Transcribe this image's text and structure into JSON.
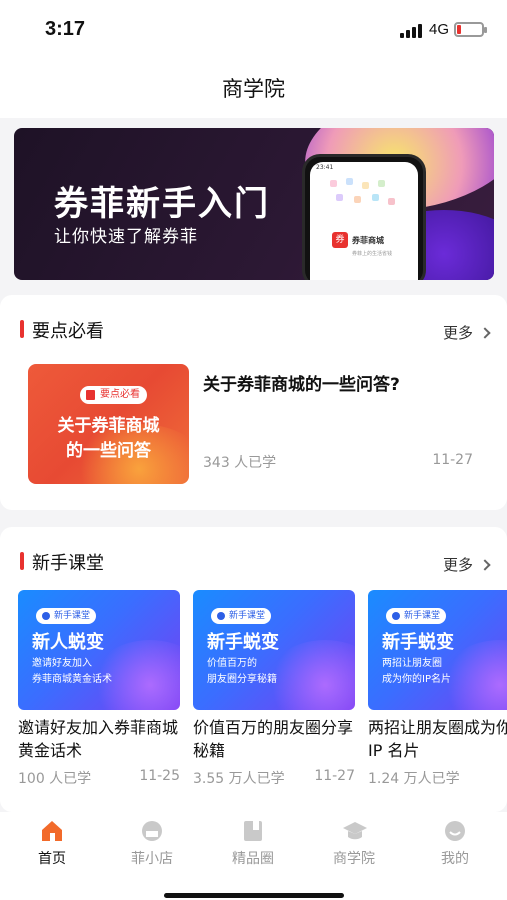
{
  "status_bar": {
    "time": "3:17",
    "network": "4G",
    "accent_low_battery": "#e8322f"
  },
  "navbar": {
    "title": "商学院"
  },
  "banner": {
    "title": "券菲新手入门",
    "subtitle": "让你快速了解券菲",
    "phone_time": "23:41",
    "phone_app_name": "券菲商城",
    "phone_app_tagline": "券菲上的生活省钱"
  },
  "key_section": {
    "title": "要点必看",
    "more": "更多",
    "item": {
      "badge": "要点必看",
      "thumb_title_line1": "关于券菲商城",
      "thumb_title_line2": "的一些问答",
      "title": "关于券菲商城的一些问答?",
      "learners": "343 人已学",
      "date": "11-27"
    }
  },
  "new_section": {
    "title": "新手课堂",
    "more": "更多",
    "courses": [
      {
        "badge": "新手课堂",
        "thumb_title": "新人蜕变",
        "thumb_sub1": "邀请好友加入",
        "thumb_sub2": "券菲商城黄金话术",
        "title": "邀请好友加入券菲商城黄金话术",
        "learners": "100 人已学",
        "date": "11-25"
      },
      {
        "badge": "新手课堂",
        "thumb_title": "新手蜕变",
        "thumb_sub1": "价值百万的",
        "thumb_sub2": "朋友圈分享秘籍",
        "title": "价值百万的朋友圈分享秘籍",
        "learners": "3.55 万人已学",
        "date": "11-27"
      },
      {
        "badge": "新手课堂",
        "thumb_title": "新手蜕变",
        "thumb_sub1": "两招让朋友圈",
        "thumb_sub2": "成为你的IP名片",
        "title": "两招让朋友圈成为你的 IP 名片",
        "learners": "1.24 万人已学",
        "date": ""
      }
    ]
  },
  "tabbar": {
    "tabs": [
      {
        "label": "首页",
        "icon": "home-icon",
        "active": true
      },
      {
        "label": "菲小店",
        "icon": "shop-icon",
        "active": false
      },
      {
        "label": "精品圈",
        "icon": "book-icon",
        "active": false
      },
      {
        "label": "商学院",
        "icon": "graduation-cap-icon",
        "active": false
      },
      {
        "label": "我的",
        "icon": "smile-icon",
        "active": false
      }
    ],
    "active_color": "#f26a2a"
  }
}
